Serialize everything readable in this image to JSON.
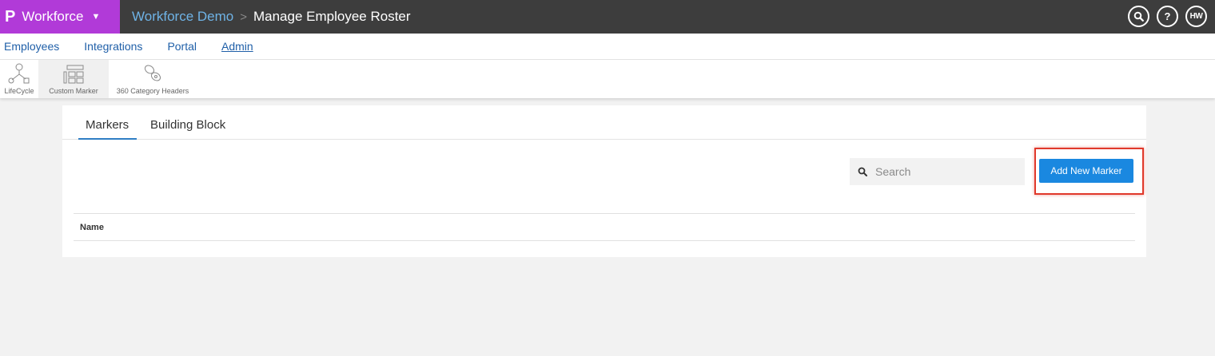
{
  "app": {
    "logo": "P",
    "name": "Workforce",
    "brand_color": "#b13ad8"
  },
  "breadcrumb": {
    "parent": "Workforce Demo",
    "separator": ">",
    "current": "Manage Employee Roster"
  },
  "header_icons": {
    "search": "search-icon",
    "help_label": "?",
    "avatar_initials": "HW"
  },
  "nav": {
    "items": [
      "Employees",
      "Integrations",
      "Portal",
      "Admin"
    ],
    "active": "Admin"
  },
  "toolbar": {
    "items": [
      {
        "label": "LifeCycle",
        "icon": "lifecycle-icon"
      },
      {
        "label": "Custom Marker",
        "icon": "custom-marker-icon",
        "selected": true
      },
      {
        "label": "360 Category Headers",
        "icon": "category-headers-icon"
      }
    ]
  },
  "tabs": {
    "items": [
      "Markers",
      "Building Block"
    ],
    "active": "Markers"
  },
  "search": {
    "placeholder": "Search",
    "value": ""
  },
  "actions": {
    "add_label": "Add New Marker",
    "accent_color": "#1a88e0",
    "highlight_color": "#e0392b"
  },
  "table": {
    "columns": [
      "Name"
    ],
    "rows": []
  }
}
